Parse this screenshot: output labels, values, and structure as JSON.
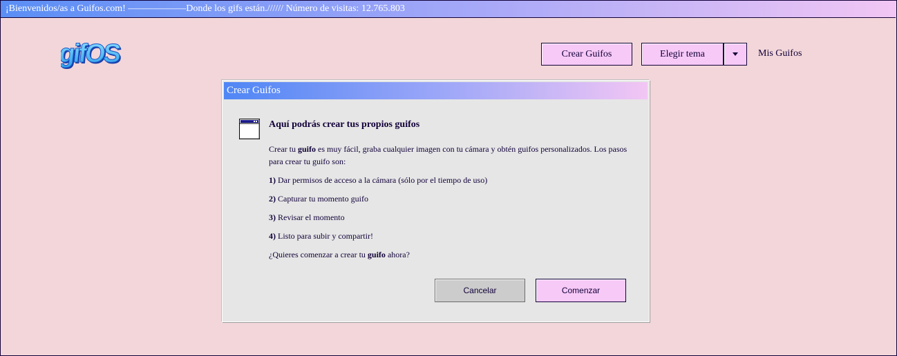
{
  "top_banner": {
    "text": "¡Bienvenidos/as a Guifos.com! ——————Donde los gifs están.////// Número de visitas: 12.765.803"
  },
  "header": {
    "logo_text": "gifOS",
    "crear_guifos_label": "Crear Guifos",
    "elegir_tema_label": "Elegir tema",
    "mis_guifos_label": "Mis Guifos"
  },
  "dialog": {
    "title": "Crear Guifos",
    "heading": "Aquí podrás crear tus propios guifos",
    "intro_prefix": "Crear tu ",
    "intro_bold": "guifo",
    "intro_suffix": " es muy fácil, graba cualquier imagen con tu cámara y obtén guifos personalizados. Los pasos para crear tu guifo son:",
    "steps": [
      {
        "num": "1)",
        "text": " Dar permisos de acceso a la cámara (sólo por el tiempo de uso)"
      },
      {
        "num": "2)",
        "text": " Capturar tu momento guifo"
      },
      {
        "num": "3)",
        "text": " Revisar el momento"
      },
      {
        "num": "4)",
        "text": " Listo para subir y compartir!"
      }
    ],
    "question_prefix": "¿Quieres comenzar a crear tu ",
    "question_bold": "guifo",
    "question_suffix": " ahora?",
    "cancel_label": "Cancelar",
    "start_label": "Comenzar"
  },
  "colors": {
    "background": "#f2d6d9",
    "accent_pink": "#f7c9f7",
    "text_dark": "#110038",
    "title_gradient_start": "#4f86f5",
    "title_gradient_end": "#f3c6f4"
  }
}
